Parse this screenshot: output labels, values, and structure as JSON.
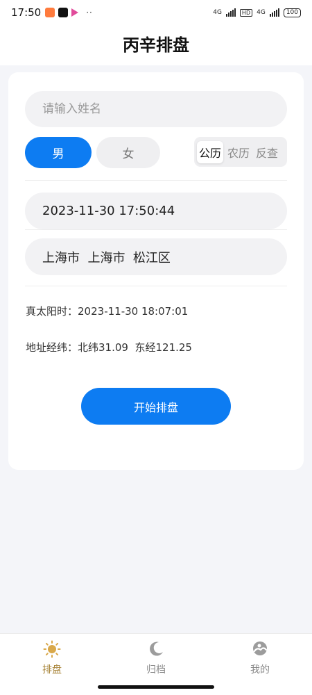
{
  "status_bar": {
    "time": "17:50",
    "network_1": "4G",
    "network_2": "4G",
    "hd": "HD",
    "battery": "100",
    "dots": "··"
  },
  "header": {
    "title": "丙辛排盘"
  },
  "form": {
    "name_placeholder": "请输入姓名",
    "gender_male": "男",
    "gender_female": "女",
    "gender_selected": "男",
    "calendar_options": [
      "公历",
      "农历",
      "反查"
    ],
    "calendar_selected": "公历",
    "datetime": "2023-11-30 17:50:44",
    "location": "上海市  上海市  松江区",
    "true_solar_time_label": "真太阳时：",
    "true_solar_time_value": "2023-11-30 18:07:01",
    "coords_label": "地址经纬：",
    "coords_value": "北纬31.09  东经121.25",
    "start_button": "开始排盘"
  },
  "tabbar": {
    "items": [
      {
        "label": "排盘",
        "icon": "sun-icon",
        "active": true
      },
      {
        "label": "归档",
        "icon": "moon-icon",
        "active": false
      },
      {
        "label": "我的",
        "icon": "cloud-icon",
        "active": false
      }
    ]
  },
  "colors": {
    "accent": "#0d7cf2",
    "active_tab": "#a8853a",
    "background": "#f4f5f9"
  }
}
